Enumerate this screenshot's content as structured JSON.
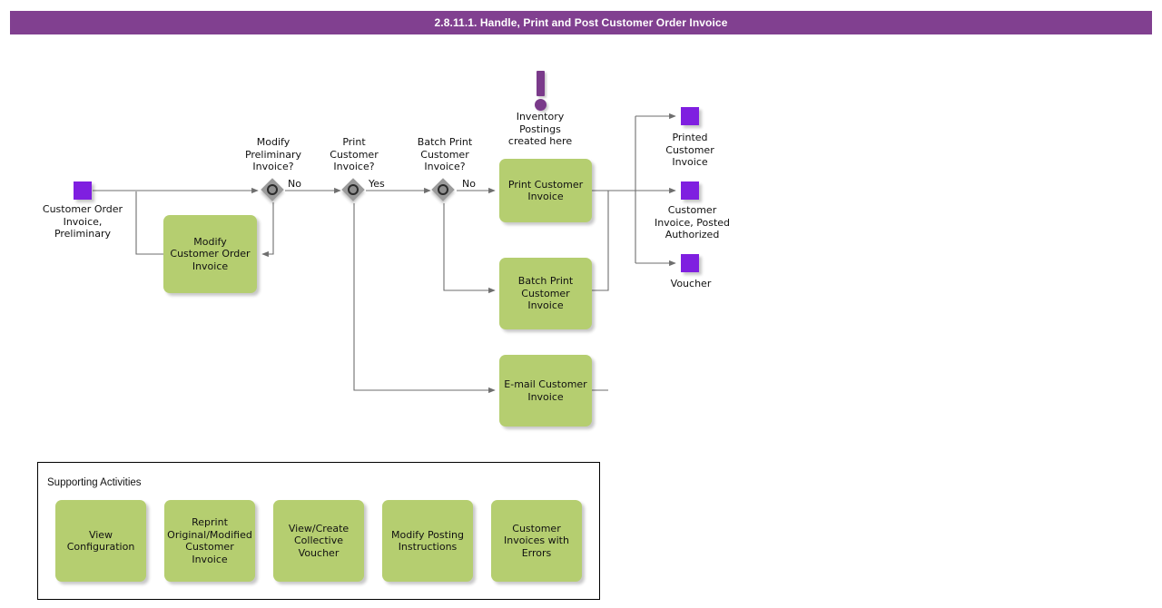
{
  "header": {
    "title": "2.8.11.1. Handle, Print and Post Customer Order Invoice",
    "background_color": "#814090",
    "text_color": "#ffffff"
  },
  "colors": {
    "activity_green": "#b5ce70",
    "terminal_purple": "#7f1fe0",
    "gateway_gray": "#9a9a9a",
    "annotation_purple": "#7a3a8a",
    "connector_gray": "#6e6e6e"
  },
  "diagram": {
    "start": {
      "name": "customer-order-invoice-preliminary",
      "label": "Customer Order\nInvoice,\nPreliminary"
    },
    "gateways": [
      {
        "id": "modify-preliminary-invoice",
        "label": "Modify\nPreliminary\nInvoice?",
        "outgoing_label": "No"
      },
      {
        "id": "print-customer-invoice",
        "label": "Print\nCustomer\nInvoice?",
        "outgoing_label": "Yes"
      },
      {
        "id": "batch-print-customer-invoice",
        "label": "Batch Print\nCustomer\nInvoice?",
        "outgoing_label": "No"
      }
    ],
    "activities": [
      {
        "id": "modify-customer-order-invoice",
        "label": "Modify\nCustomer Order\nInvoice"
      },
      {
        "id": "print-customer-invoice",
        "label": "Print Customer\nInvoice"
      },
      {
        "id": "batch-print-customer-invoice",
        "label": "Batch Print\nCustomer\nInvoice"
      },
      {
        "id": "email-customer-invoice",
        "label": "E-mail Customer\nInvoice"
      }
    ],
    "annotation": {
      "icon": "exclamation-icon",
      "text": "Inventory\nPostings\ncreated here"
    },
    "end_nodes": [
      {
        "id": "printed-customer-invoice",
        "label": "Printed\nCustomer\nInvoice"
      },
      {
        "id": "customer-invoice-posted-authorized",
        "label": "Customer\nInvoice, Posted\nAuthorized"
      },
      {
        "id": "voucher",
        "label": "Voucher"
      }
    ]
  },
  "supporting_activities": {
    "title": "Supporting Activities",
    "items": [
      {
        "id": "view-configuration",
        "label": "View\nConfiguration"
      },
      {
        "id": "reprint-original-modified-customer-invoice",
        "label": "Reprint\nOriginal/Modified\nCustomer\nInvoice"
      },
      {
        "id": "view-create-collective-voucher",
        "label": "View/Create\nCollective\nVoucher"
      },
      {
        "id": "modify-posting-instructions",
        "label": "Modify Posting\nInstructions"
      },
      {
        "id": "customer-invoices-with-errors",
        "label": "Customer\nInvoices with\nErrors"
      }
    ]
  }
}
